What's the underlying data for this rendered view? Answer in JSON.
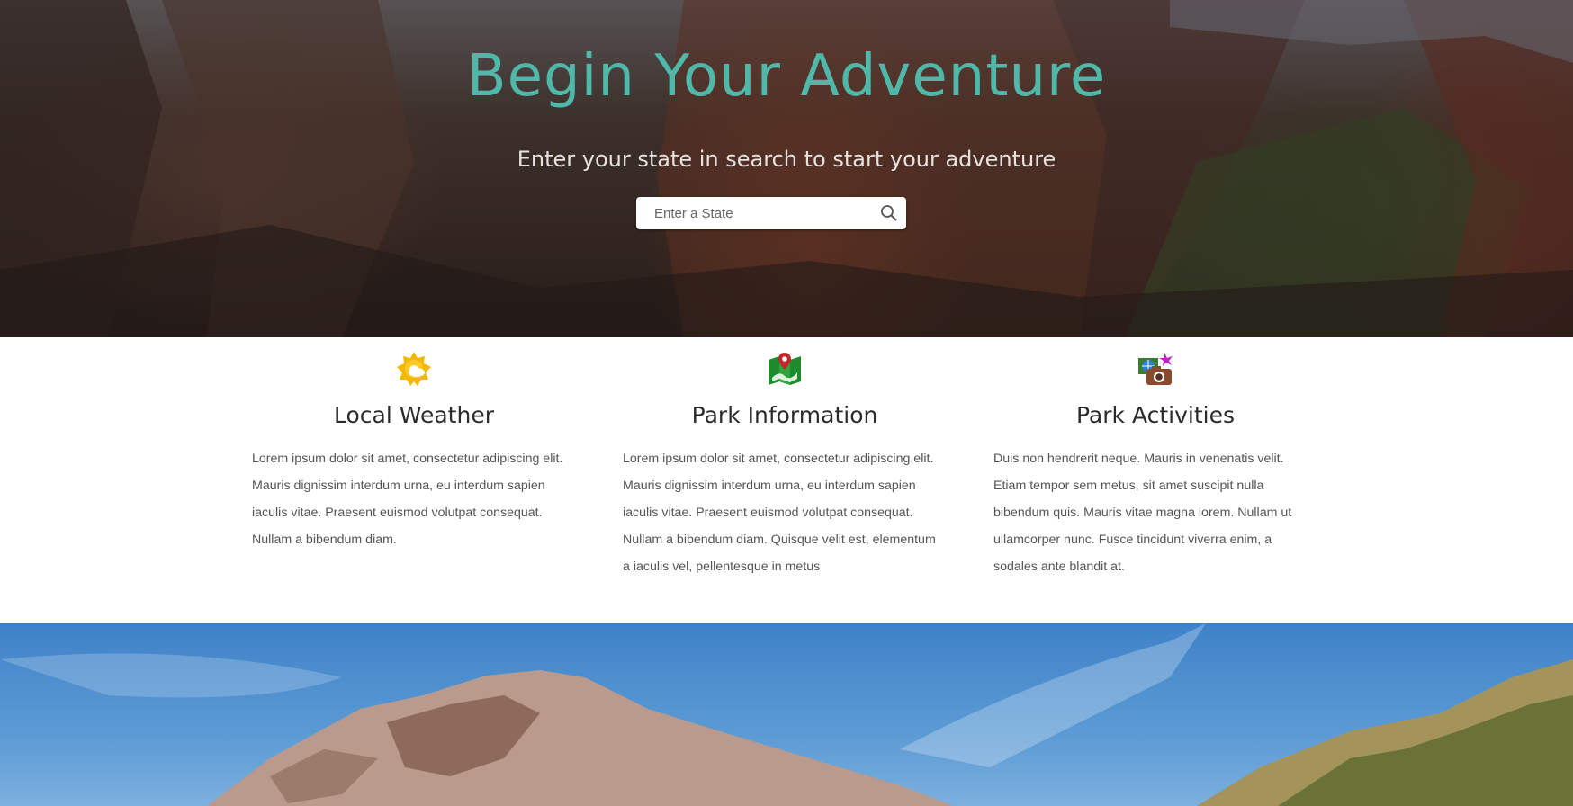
{
  "hero": {
    "title": "Begin Your Adventure",
    "subtitle": "Enter your state in search to start your adventure",
    "search": {
      "placeholder": "Enter a State",
      "value": ""
    },
    "title_color": "#4fb8a8"
  },
  "features": [
    {
      "icon": "weather-sun-cloud-icon",
      "title": "Local Weather",
      "text": "Lorem ipsum dolor sit amet, consectetur adipiscing elit. Mauris dignissim interdum urna, eu interdum sapien iaculis vitae. Praesent euismod volutpat consequat. Nullam a bibendum diam."
    },
    {
      "icon": "map-pin-icon",
      "title": "Park Information",
      "text": "Lorem ipsum dolor sit amet, consectetur adipiscing elit. Mauris dignissim interdum urna, eu interdum sapien iaculis vitae. Praesent euismod volutpat consequat. Nullam a bibendum diam. Quisque velit est, elementum a iaculis vel, pellentesque in metus"
    },
    {
      "icon": "camera-globe-icon",
      "title": "Park Activities",
      "text": "Duis non hendrerit neque. Mauris in venenatis velit. Etiam tempor sem metus, sit amet suscipit nulla bibendum quis. Mauris vitae magna lorem. Nullam ut ullamcorper nunc. Fusce tincidunt viverra enim, a sodales ante blandit at."
    }
  ]
}
